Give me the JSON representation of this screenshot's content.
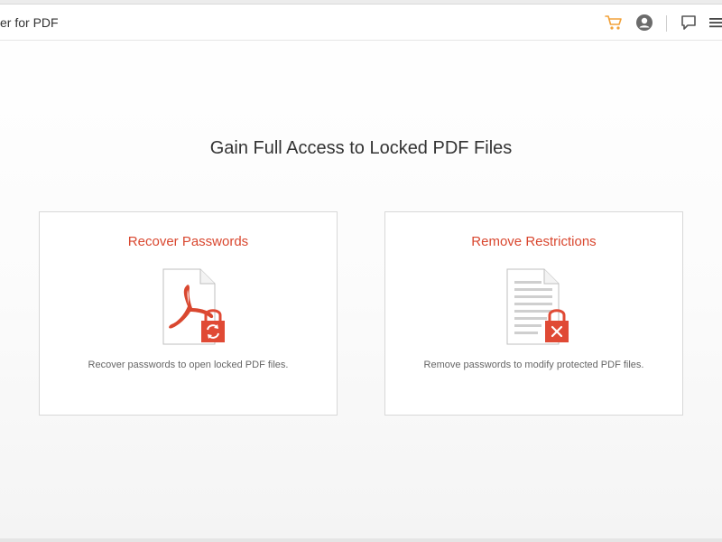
{
  "app": {
    "title": "er for PDF"
  },
  "toolbar": {
    "icons": [
      "cart-icon",
      "user-icon",
      "feedback-icon",
      "menu-icon"
    ],
    "accent": "#f2a23a"
  },
  "main": {
    "headline": "Gain Full Access to Locked PDF Files"
  },
  "cards": [
    {
      "title": "Recover Passwords",
      "description": "Recover passwords to open locked PDF files.",
      "icon": "pdf-lock-recover-icon"
    },
    {
      "title": "Remove Restrictions",
      "description": "Remove passwords to modify protected PDF files.",
      "icon": "document-lock-remove-icon"
    }
  ],
  "colors": {
    "brand_red": "#d9472f",
    "lock_red": "#e04a35",
    "text_dark": "#333333",
    "text_muted": "#666666"
  }
}
